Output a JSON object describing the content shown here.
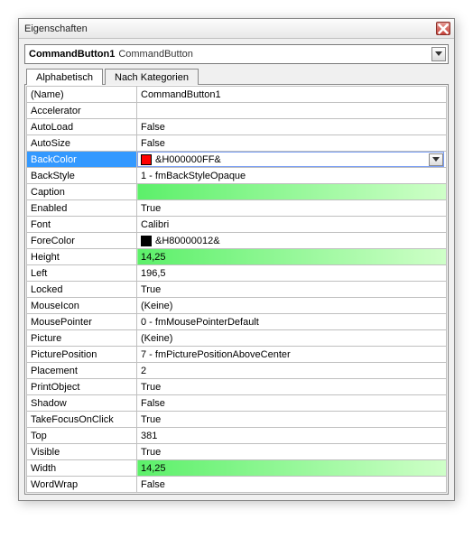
{
  "window": {
    "title": "Eigenschaften"
  },
  "object": {
    "name": "CommandButton1",
    "type": "CommandButton"
  },
  "tabs": {
    "alpha": "Alphabetisch",
    "cat": "Nach Kategorien"
  },
  "rows": [
    {
      "key": "(Name)",
      "val": "CommandButton1"
    },
    {
      "key": "Accelerator",
      "val": ""
    },
    {
      "key": "AutoLoad",
      "val": "False"
    },
    {
      "key": "AutoSize",
      "val": "False"
    },
    {
      "key": "BackColor",
      "val": "&H000000FF&",
      "swatch": "#ff0000",
      "selected": true
    },
    {
      "key": "BackStyle",
      "val": "1 - fmBackStyleOpaque"
    },
    {
      "key": "Caption",
      "val": "",
      "highlight": true
    },
    {
      "key": "Enabled",
      "val": "True"
    },
    {
      "key": "Font",
      "val": "Calibri"
    },
    {
      "key": "ForeColor",
      "val": "&H80000012&",
      "swatch": "#000000"
    },
    {
      "key": "Height",
      "val": "14,25",
      "highlight": true
    },
    {
      "key": "Left",
      "val": "196,5"
    },
    {
      "key": "Locked",
      "val": "True"
    },
    {
      "key": "MouseIcon",
      "val": "(Keine)"
    },
    {
      "key": "MousePointer",
      "val": "0 - fmMousePointerDefault"
    },
    {
      "key": "Picture",
      "val": "(Keine)"
    },
    {
      "key": "PicturePosition",
      "val": "7 - fmPicturePositionAboveCenter"
    },
    {
      "key": "Placement",
      "val": "2"
    },
    {
      "key": "PrintObject",
      "val": "True"
    },
    {
      "key": "Shadow",
      "val": "False"
    },
    {
      "key": "TakeFocusOnClick",
      "val": "True"
    },
    {
      "key": "Top",
      "val": "381"
    },
    {
      "key": "Visible",
      "val": "True"
    },
    {
      "key": "Width",
      "val": "14,25",
      "highlight": true
    },
    {
      "key": "WordWrap",
      "val": "False"
    }
  ]
}
